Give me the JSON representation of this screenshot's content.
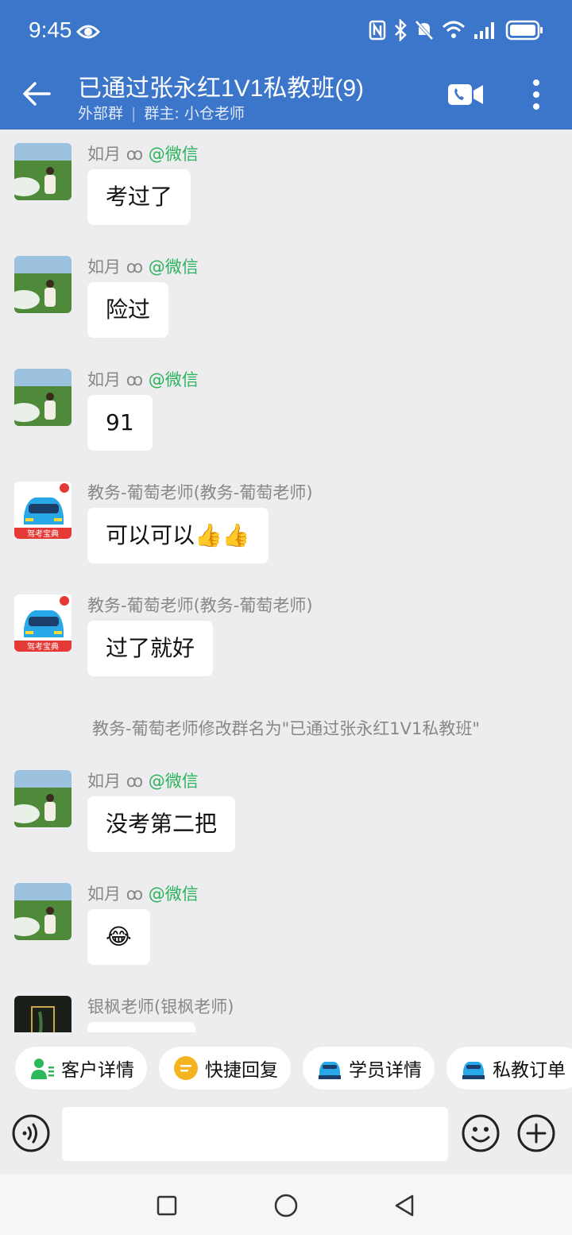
{
  "status_bar": {
    "time": "9:45"
  },
  "header": {
    "title": "已通过张永红1V1私教班(9)",
    "group_type": "外部群",
    "owner": "群主: 小仓老师"
  },
  "messages": [
    {
      "sender": "如月",
      "source": "@微信",
      "text": "考过了"
    },
    {
      "sender": "如月",
      "source": "@微信",
      "text": "险过"
    },
    {
      "sender": "如月",
      "source": "@微信",
      "text": "91"
    },
    {
      "sender": "教务-葡萄老师(教务-葡萄老师)",
      "text": "可以可以",
      "emoji": [
        "👍",
        "👍"
      ]
    },
    {
      "sender": "教务-葡萄老师(教务-葡萄老师)",
      "text": "过了就好"
    },
    {
      "sender": "如月",
      "source": "@微信",
      "text": "没考第二把"
    },
    {
      "sender": "如月",
      "source": "@微信",
      "emoji": "😂"
    },
    {
      "sender": "银枫老师(银枫老师)"
    }
  ],
  "system_notice": "教务-葡萄老师修改群名为\"已通过张永红1V1私教班\"",
  "avatar_logo_text": "驾考宝典",
  "quick_actions": [
    "客户详情",
    "快捷回复",
    "学员详情",
    "私教订单"
  ],
  "colors": {
    "header": "#3B76CA",
    "wechat_tag": "#2BB35B",
    "chat_bg": "#EDEDF0"
  }
}
